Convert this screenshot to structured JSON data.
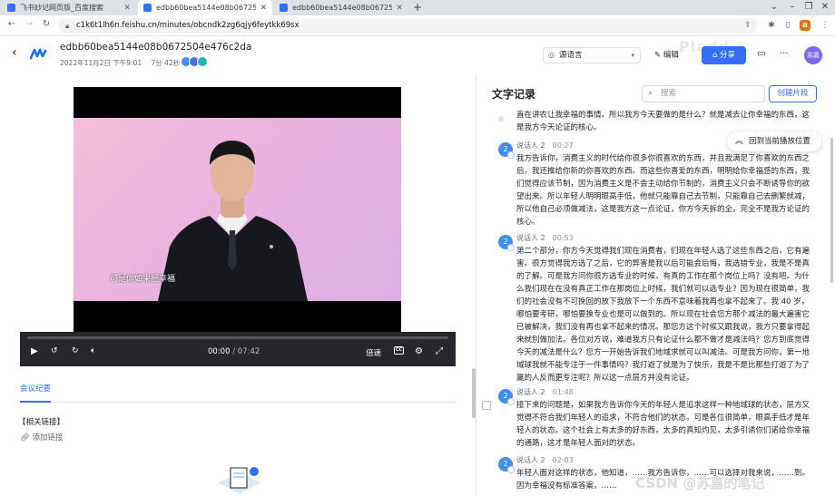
{
  "browser": {
    "tabs": [
      {
        "title": "飞书妙记网页版_百度搜索",
        "favicon_color": "#3370ff",
        "active": false
      },
      {
        "title": "edbb60bea5144e08b0672504",
        "favicon_color": "#3370ff",
        "active": true
      },
      {
        "title": "edbb60bea5144e08b0672504",
        "favicon_color": "#3370ff",
        "active": false
      }
    ],
    "new_tab": "+",
    "url": "c1k6t1lh6n.feishu.cn/minutes/obcndk2zg6qjy6feytkk69sx"
  },
  "header": {
    "title": "edbb60bea5144e08b0672504e476c2da",
    "date": "2022年11月2日 下午9:01",
    "duration": "7分 42秒",
    "source_language": "源语言",
    "edit": "编辑",
    "share": "分享",
    "user_initials": "苏嘉",
    "watermark": "Pladd"
  },
  "player": {
    "caption": "可是你如果把幸福",
    "current_time": "00:00",
    "separator": " / ",
    "total_time": "07:42",
    "speed": "倍速",
    "cc_label": "CC",
    "progress": 0.0
  },
  "left": {
    "tab_minutes": "会议纪要",
    "related_links": "【相关链接】",
    "add_link": "添加链接"
  },
  "transcript": {
    "title": "文字记录",
    "search_placeholder": "搜索",
    "create_clip": "创建片段",
    "back_to_position": "回到当前播放位置",
    "first_text": "直在讲农让我幸福的事情。所以我方今天要做的是什么？就是减去让你幸福的东西，这是我方今天论证的核心。",
    "segments": [
      {
        "speaker": "说话人 2",
        "time": "00:27",
        "text": "我方告诉你，消费主义的时代给你很多你很喜欢的东西，并且我满足了你喜欢的东西之后，我还推给你新的你喜欢的东西。而这些你喜爱的东西，明明给你幸福感的东西，我们觉得应该节制，因为消费主义是不会主动给你节制的，消费主义只会不断诱导你的欲望出来。所以年轻人明明眼高手低，他就只能靠自己去节制，只能靠自己去删繁就减，所以他自己必须做减法，这是我方这一点论证，你方今天拆的全，完全不是我方论证的核心。"
      },
      {
        "speaker": "说话人 2",
        "time": "00:53",
        "text": "第二个部分，你方今天觉得我们现在消费者，们现在年轻人选了这些东西之后，它有遍害。很方觉得我方选了之后，它的弊害是我以后可能会后悔，我选错专业，我是不是真的了解。可是我方问你很方选专业的时候，有真的工作在那个岗位上吗？没有吧。为什么我们现在在没有真正工作在那岗位上时候，我们就可以选专业？因为现在很简单，我们的社会没有不可挽回的放下我放下一个东西不意味着我再也拿不起来了。我 40 岁，哪怕要考研，哪怕要换专业也是可以做到的。所以现在社会您方那个减法的最大遍害它已被解决，我们没有再也拿不起来的情况。那您方这个时候又跟我说，我方只要拿得起来就別做加法。各位对方说，难道我方只有论证什么都不做才是减法吗？您方到底觉得今天的减法是什么？您方一开始告诉我们地域求就可以叫减法。可是我方问你，第一地域球我就不能专注于一件事情吗？我打遊了就是为了快乐，我是不是比那些打遊了为了羸的人反而更专注呢？所以这一点层方并没有论证。"
      },
      {
        "speaker": "说话人 2",
        "time": "01:48",
        "text": "接下来的问题是，如果我方告诉你今天的年轻人是追求这样一种地域球的状态，层方又觉得不符合我们年轻人的追求，不符合他们的状态。可是各位很简单，眼高手低才是年轻人的状态。这个社会上有太多的好东西，太多的真知灼见，太多引诱你们诺给你幸福的通路，这才是年轻人面对的状态。"
      },
      {
        "speaker": "说话人 2",
        "time": "02:03",
        "text": "年轻人面对这样的状态，他知道，……我方告诉你，……可以选择对我来说，……到。因为幸福没有标准答案，……"
      }
    ]
  },
  "bottom_watermark": "CSDN @苏嘉的笔记"
}
